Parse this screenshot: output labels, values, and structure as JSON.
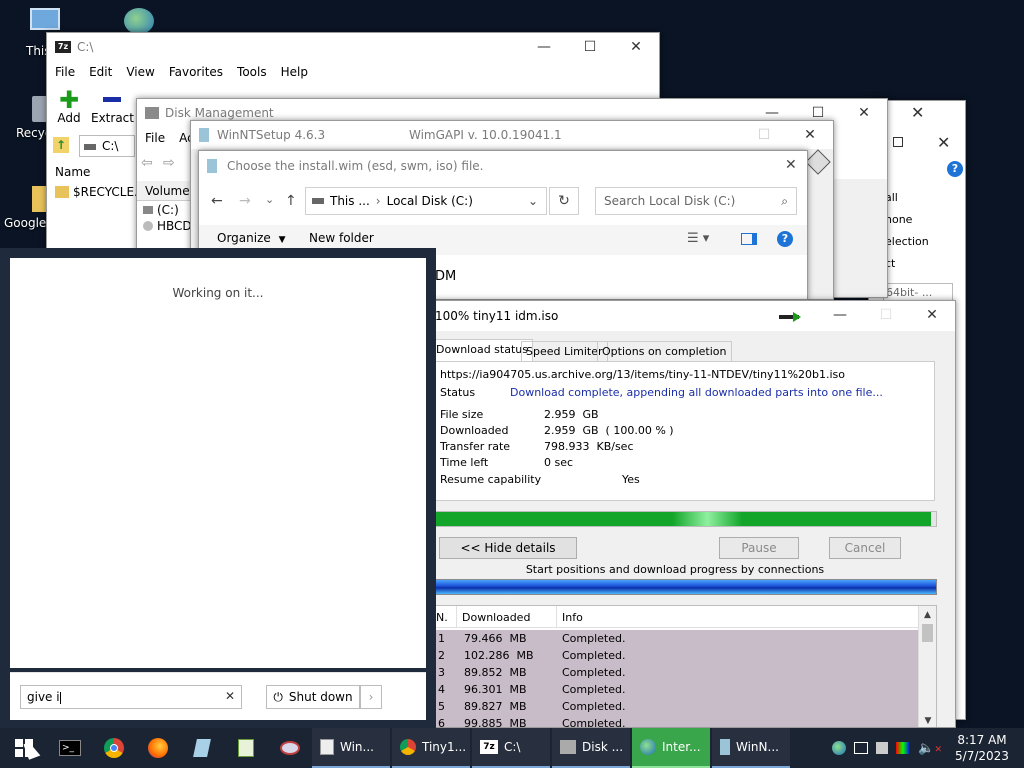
{
  "desktop": {
    "icons": [
      {
        "label": "This"
      },
      {
        "label": "Recyc"
      },
      {
        "label": "Google"
      }
    ]
  },
  "win_7zip": {
    "title": "C:\\",
    "menu": [
      "File",
      "Edit",
      "View",
      "Favorites",
      "Tools",
      "Help"
    ],
    "toolbar": {
      "add": "Add",
      "extract": "Extract"
    },
    "path": "C:\\",
    "column_name": "Name",
    "rows": [
      "$RECYCLE.B"
    ]
  },
  "win_disk": {
    "title": "Disk Management",
    "menu": [
      "File",
      "Ac"
    ],
    "column_volume": "Volume",
    "rows": [
      "(C:)",
      "HBCD"
    ]
  },
  "win_winnt": {
    "title": "WinNTSetup 4.6.3",
    "subtitle": "WimGAPI v. 10.0.19041.1"
  },
  "back_frag": {
    "texts": [
      "all",
      "none",
      "election",
      "ct",
      "64bit- ..."
    ]
  },
  "dialog": {
    "title": "Choose the install.wim (esd, swm, iso) file.",
    "address": [
      "This ...",
      "Local Disk (C:)"
    ],
    "search_placeholder": "Search Local Disk (C:)",
    "organize": "Organize",
    "new_folder": "New folder",
    "peek_text": "DM"
  },
  "start_panel": {
    "working": "Working on it...",
    "search_value": "give i",
    "shutdown": "Shut down"
  },
  "idm": {
    "title": "100% tiny11 idm.iso",
    "tabs": [
      "Download status",
      "Speed Limiter",
      "Options on completion"
    ],
    "url": "https://ia904705.us.archive.org/13/items/tiny-11-NTDEV/tiny11%20b1.iso",
    "status_label": "Status",
    "status_value": "Download complete, appending all downloaded parts into one file...",
    "fields": [
      {
        "label": "File size",
        "value": "2.959  GB"
      },
      {
        "label": "Downloaded",
        "value": "2.959  GB  ( 100.00 % )"
      },
      {
        "label": "Transfer rate",
        "value": "798.933  KB/sec"
      },
      {
        "label": "Time left",
        "value": "0 sec"
      }
    ],
    "resume_label": "Resume capability",
    "resume_value": "Yes",
    "progress": 0.99,
    "hide_details": "<< Hide details",
    "pause": "Pause",
    "cancel": "Cancel",
    "connections_caption": "Start positions and download progress by connections",
    "columns": [
      "N.",
      "Downloaded",
      "Info"
    ],
    "connections": [
      {
        "n": "1",
        "downloaded": "79.466  MB",
        "info": "Completed."
      },
      {
        "n": "2",
        "downloaded": "102.286  MB",
        "info": "Completed."
      },
      {
        "n": "3",
        "downloaded": "89.852  MB",
        "info": "Completed."
      },
      {
        "n": "4",
        "downloaded": "96.301  MB",
        "info": "Completed."
      },
      {
        "n": "5",
        "downloaded": "89.827  MB",
        "info": "Completed."
      },
      {
        "n": "6",
        "downloaded": "99.885  MB",
        "info": "Completed."
      }
    ]
  },
  "taskbar": {
    "windows": [
      {
        "label": "Win...",
        "icon": "document-icon"
      },
      {
        "label": "Tiny1...",
        "icon": "chrome-icon"
      },
      {
        "label": "C:\\",
        "icon": "7zip-icon"
      },
      {
        "label": "Disk ...",
        "icon": "disk-icon"
      },
      {
        "label": "Inter...",
        "icon": "idm-icon"
      },
      {
        "label": "WinN...",
        "icon": "setup-icon"
      }
    ],
    "time": "8:17 AM",
    "date": "5/7/2023"
  }
}
